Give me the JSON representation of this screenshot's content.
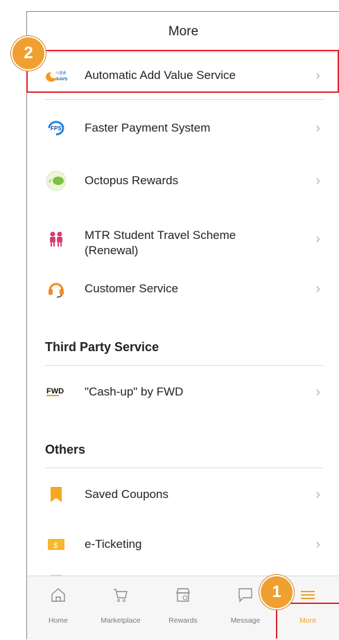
{
  "header": {
    "title": "More"
  },
  "menu": [
    {
      "label": "Automatic Add Value Service",
      "icon": "aavs-icon"
    },
    {
      "label": "Faster Payment System",
      "icon": "fps-icon"
    },
    {
      "label": "Octopus Rewards",
      "icon": "octopus-rewards-icon"
    },
    {
      "label": "MTR Student Travel Scheme",
      "label2": "(Renewal)",
      "icon": "mtr-student-icon"
    },
    {
      "label": "Customer Service",
      "icon": "headset-icon"
    }
  ],
  "third_party": {
    "heading": "Third Party Service",
    "items": [
      {
        "label": "\"Cash-up\" by FWD",
        "icon": "fwd-logo-icon"
      }
    ]
  },
  "others": {
    "heading": "Others",
    "items": [
      {
        "label": "Saved Coupons",
        "icon": "bookmark-icon"
      },
      {
        "label": "e-Ticketing",
        "icon": "ticket-icon"
      }
    ]
  },
  "tabbar": {
    "tabs": [
      {
        "label": "Home",
        "icon": "home-icon"
      },
      {
        "label": "Marketplace",
        "icon": "cart-icon"
      },
      {
        "label": "Rewards",
        "icon": "store-icon"
      },
      {
        "label": "Message",
        "icon": "chat-icon"
      },
      {
        "label": "More",
        "icon": "menu-icon",
        "active": true
      }
    ]
  },
  "annotations": {
    "step1": "1",
    "step2": "2"
  },
  "colors": {
    "accent": "#f0a030",
    "highlight": "#e2232a",
    "active_tab": "#f0a030"
  }
}
